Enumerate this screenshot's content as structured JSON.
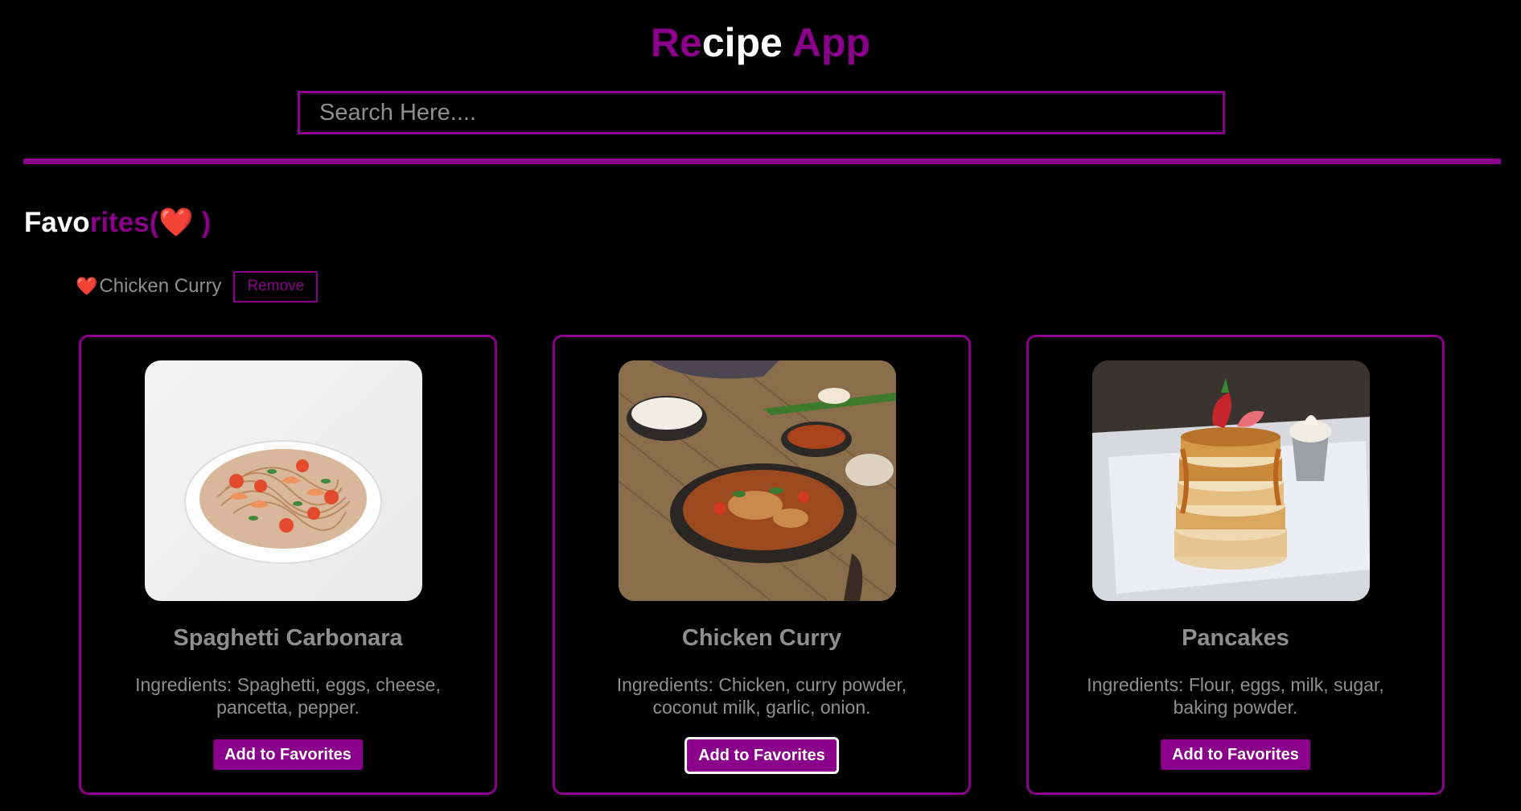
{
  "header": {
    "title_parts": [
      "Re",
      "cipe",
      " App"
    ],
    "search_placeholder": "Search Here...."
  },
  "favorites": {
    "heading_parts": [
      "Favo",
      "rites(",
      "❤️",
      " )"
    ],
    "items": [
      {
        "icon": "heart-icon",
        "name": "Chicken Curry",
        "remove_label": "Remove"
      }
    ]
  },
  "recipes": [
    {
      "title": "Spaghetti Carbonara",
      "ingredients": "Ingredients: Spaghetti, eggs, cheese, pancetta, pepper.",
      "button_label": "Add to Favorites",
      "image": "spaghetti-image"
    },
    {
      "title": "Chicken Curry",
      "ingredients": "Ingredients: Chicken, curry powder, coconut milk, garlic, onion.",
      "button_label": "Add to Favorites",
      "image": "chicken-curry-image"
    },
    {
      "title": "Pancakes",
      "ingredients": "Ingredients: Flour, eggs, milk, sugar, baking powder.",
      "button_label": "Add to Favorites",
      "image": "pancakes-image"
    }
  ],
  "colors": {
    "accent": "#8b008b",
    "background": "#000000",
    "text_muted": "#8f8f8f",
    "heart": "#e8212e"
  }
}
